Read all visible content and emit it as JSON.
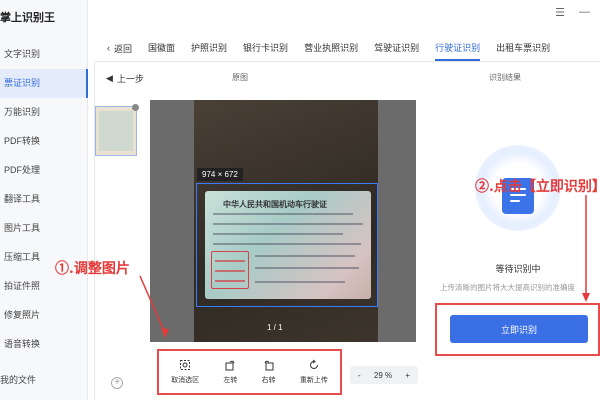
{
  "app": {
    "title": "掌上识别王"
  },
  "sidebar": {
    "items": [
      {
        "label": "文字识别",
        "active": false
      },
      {
        "label": "票证识别",
        "active": true
      },
      {
        "label": "万能识别",
        "active": false
      },
      {
        "label": "PDF转换",
        "active": false
      },
      {
        "label": "PDF处理",
        "active": false
      },
      {
        "label": "翻译工具",
        "active": false
      },
      {
        "label": "图片工具",
        "active": false
      },
      {
        "label": "压缩工具",
        "active": false
      },
      {
        "label": "拍证件照",
        "active": false
      },
      {
        "label": "修复照片",
        "active": false
      },
      {
        "label": "语音转换",
        "active": false
      }
    ],
    "my_files": "我的文件"
  },
  "topbar": {
    "back_label": "返回",
    "tabs": [
      {
        "label": "国徽面",
        "active": false
      },
      {
        "label": "护照识别",
        "active": false
      },
      {
        "label": "银行卡识别",
        "active": false
      },
      {
        "label": "营业执照识别",
        "active": false
      },
      {
        "label": "驾驶证识别",
        "active": false
      },
      {
        "label": "行驶证识别",
        "active": true
      },
      {
        "label": "出租车票识别",
        "active": false
      }
    ]
  },
  "subbar": {
    "prev_label": "上一步",
    "original_label": "原图",
    "result_label": "识别结果"
  },
  "preview": {
    "dimension_label": "974 × 672",
    "page_indicator": "1 / 1",
    "card_title": "中华人民共和国机动车行驶证"
  },
  "toolbar": {
    "cancel_label": "取消选区",
    "rotate_left_label": "左转",
    "rotate_right_label": "右转",
    "reupload_label": "重新上传"
  },
  "zoom": {
    "minus": "-",
    "value": "29 %",
    "plus": "+"
  },
  "result": {
    "waiting_text": "等待识别中",
    "hint_text": "上传清晰的图片将大大提高识别的准确度",
    "recognize_button": "立即识别"
  },
  "annotations": {
    "step1": "①.调整图片",
    "step2": "②.点击【立即识别】"
  },
  "colors": {
    "accent": "#2f6bd9",
    "annotation_red": "#e53a3a",
    "button_blue": "#3a6fe6"
  }
}
